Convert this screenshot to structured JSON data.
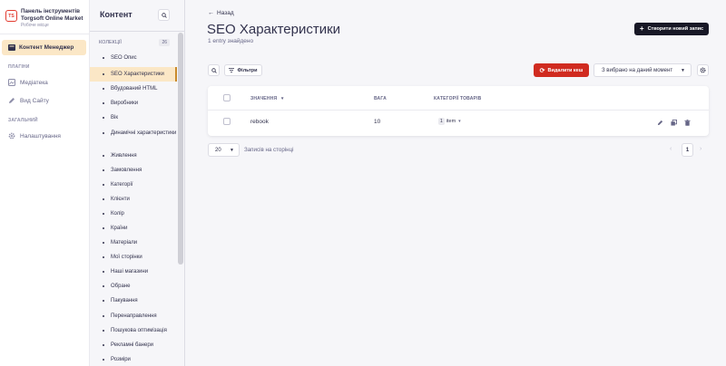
{
  "brand": {
    "logo_text": "TS",
    "title_line1": "Панель інструментів",
    "title_line2": "Torgsoft Online Market",
    "subtitle": "Робоче місце"
  },
  "mainnav": {
    "active_item": "Контент Менеджер",
    "plugins_section": "ПЛАГІНИ",
    "plugins": [
      "Медіатека",
      "Вид Сайту"
    ],
    "general_section": "ЗАГАЛЬНИЙ",
    "general": [
      "Налаштування"
    ]
  },
  "subnav": {
    "title": "Контент",
    "collections_label": "КОЛЕКЦІЇ",
    "collections_count": "26",
    "items": [
      "SEO Опис",
      "SEO Характеристики",
      "Вбудований HTML",
      "Виробники",
      "Вік",
      "Динамічні характеристики",
      "Живлення",
      "Замовлення",
      "Категорії",
      "Клієнти",
      "Колір",
      "Країни",
      "Матеріали",
      "Мої сторінки",
      "Наші магазини",
      "Обране",
      "Пакування",
      "Перенаправлення",
      "Пошукова оптимізація",
      "Рекламні банери",
      "Розміри"
    ],
    "active_index": 1
  },
  "content": {
    "back_label": "Назад",
    "title": "SEO Характеристики",
    "entries_found": "1 entry знайдено",
    "create_button": "Створити новий запис",
    "filters_button": "Фільтри",
    "delete_cache_button": "Видалити кеш",
    "select_now": "З вибрано на даний момент",
    "table": {
      "headers": [
        "ЗНАЧЕННЯ",
        "ВАГА",
        "КАТЕГОРІЇ ТОВАРІВ"
      ],
      "rows": [
        {
          "value": "rebook",
          "weight": "10",
          "categories_count": "1",
          "categories_label": "item"
        }
      ]
    },
    "pagination": {
      "per_page": "20",
      "per_page_label": "Записів на сторінці",
      "current_page": "1"
    }
  },
  "colors": {
    "accent_active_bg": "#fbe7c6",
    "danger": "#d02b20",
    "primary_dark": "#181826"
  }
}
